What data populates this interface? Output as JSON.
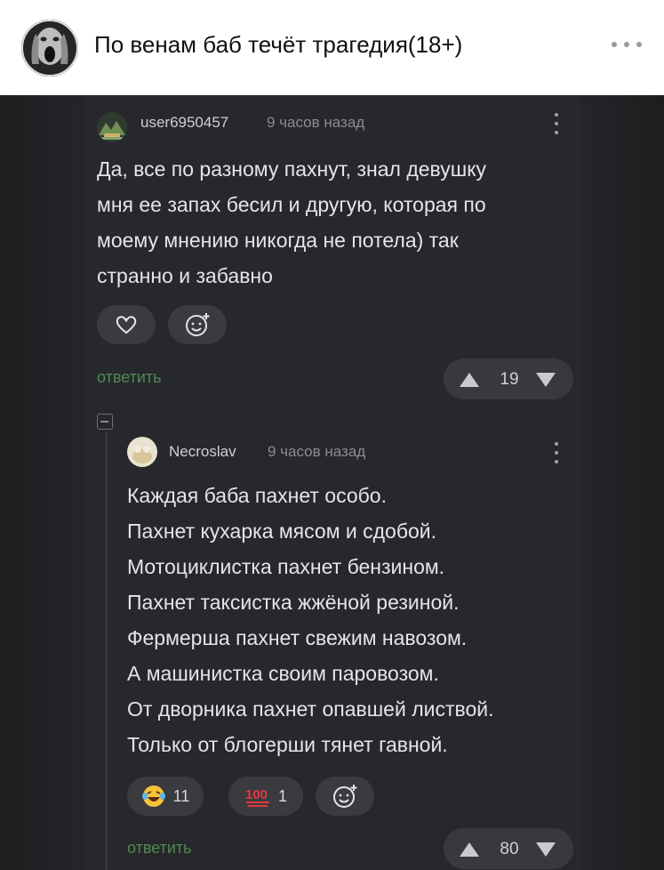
{
  "header": {
    "title": "По венам баб течёт трагедия(18+)",
    "avatar_icon": "screaming-face-avatar",
    "menu_icon": "more-dots-icon"
  },
  "comments": [
    {
      "username": "user6950457",
      "time": "9 часов назад",
      "lines": [
        "Да, все по разному пахнут, знал девушку",
        "мня ее запах бесил и другую, которая по",
        "моему мнению никогда не потела) так",
        "странно и забавно"
      ],
      "reply_label": "ответить",
      "rating": "19"
    },
    {
      "username": "Necroslav",
      "time": "9 часов назад",
      "lines": [
        "Каждая баба пахнет особо.",
        "Пахнет кухарка мясом и сдобой.",
        "Мотоциклистка пахнет бензином.",
        "Пахнет таксистка жжёной резиной.",
        "Фермерша пахнет свежим навозом.",
        "А машинистка своим паровозом.",
        "От дворника пахнет опавшей листвой.",
        "Только от блогерши тянет гавной."
      ],
      "reactions": [
        {
          "icon": "laughing-tears-emoji-icon",
          "count": "11"
        },
        {
          "icon": "hundred-points-emoji-icon",
          "count": "1"
        }
      ],
      "reply_label": "ответить",
      "rating": "80"
    }
  ]
}
